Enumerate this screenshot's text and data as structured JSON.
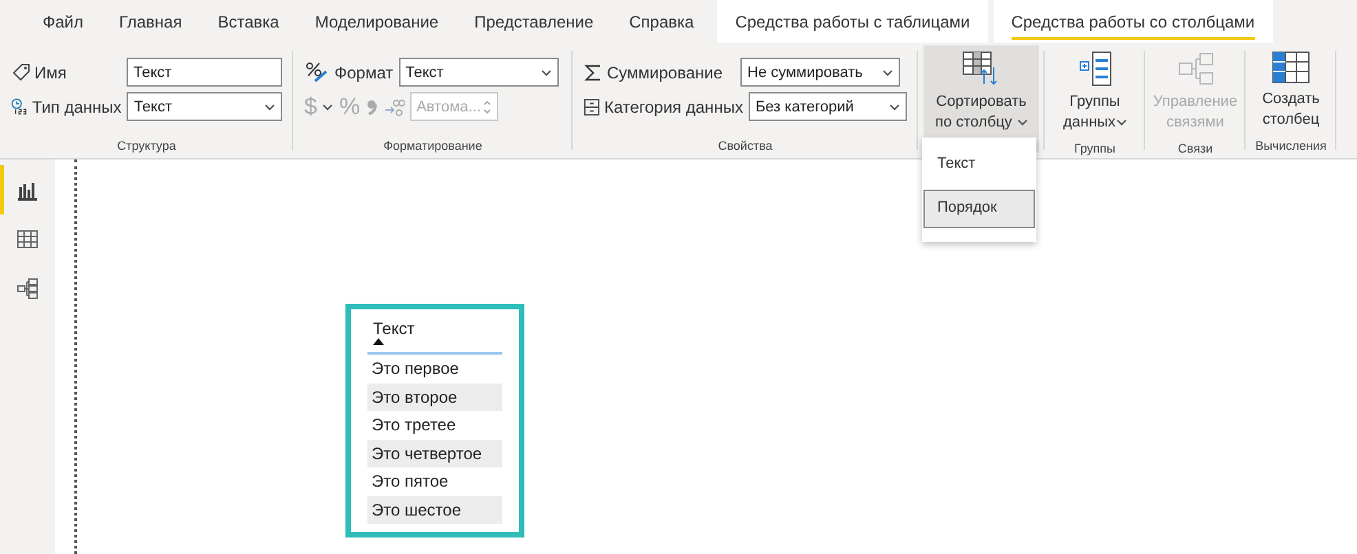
{
  "tabs": [
    {
      "label": "Файл",
      "kind": "main",
      "selected": false
    },
    {
      "label": "Главная",
      "kind": "main",
      "selected": false
    },
    {
      "label": "Вставка",
      "kind": "main",
      "selected": false
    },
    {
      "label": "Моделирование",
      "kind": "main",
      "selected": false
    },
    {
      "label": "Представление",
      "kind": "main",
      "selected": false
    },
    {
      "label": "Справка",
      "kind": "main",
      "selected": false
    },
    {
      "label": "Средства работы с таблицами",
      "kind": "context",
      "selected": false
    },
    {
      "label": "Средства работы со столбцами",
      "kind": "context",
      "selected": true
    }
  ],
  "structure": {
    "label": "Структура",
    "rows": [
      {
        "label": "Имя",
        "value": "Текст",
        "dropdown": false
      },
      {
        "label": "Тип данных",
        "value": "Текст",
        "dropdown": true
      }
    ]
  },
  "formatting": {
    "label": "Форматирование",
    "format_label": "Формат",
    "format_value": "Текст",
    "currency": "$",
    "percent": "%",
    "decimals_placeholder": "Автома...",
    "disabled": true
  },
  "properties": {
    "label": "Свойства",
    "rows": [
      {
        "label": "Суммирование",
        "value": "Не суммировать"
      },
      {
        "label": "Категория данных",
        "value": "Без категорий"
      }
    ]
  },
  "sort": {
    "label": "Сортировать по столбцу",
    "pressed": true,
    "menu": [
      {
        "label": "Текст",
        "selected": false
      },
      {
        "label": "Порядок",
        "selected": true
      }
    ]
  },
  "groups": [
    {
      "label": "Группы",
      "buttons": [
        {
          "label": "Группы данных",
          "dropdown": true,
          "disabled": false
        }
      ]
    },
    {
      "label": "Связи",
      "buttons": [
        {
          "label": "Управление связями",
          "dropdown": false,
          "disabled": true
        }
      ]
    },
    {
      "label": "Вычисления",
      "buttons": [
        {
          "label": "Создать столбец",
          "dropdown": false,
          "disabled": false
        }
      ]
    }
  ],
  "views": [
    {
      "kind": "report",
      "selected": true
    },
    {
      "kind": "table",
      "selected": false
    },
    {
      "kind": "model",
      "selected": false
    }
  ],
  "visual": {
    "header": "Текст",
    "rows": [
      "Это первое",
      "Это второе",
      "Это третее",
      "Это четвертое",
      "Это пятое",
      "Это шестое"
    ]
  }
}
